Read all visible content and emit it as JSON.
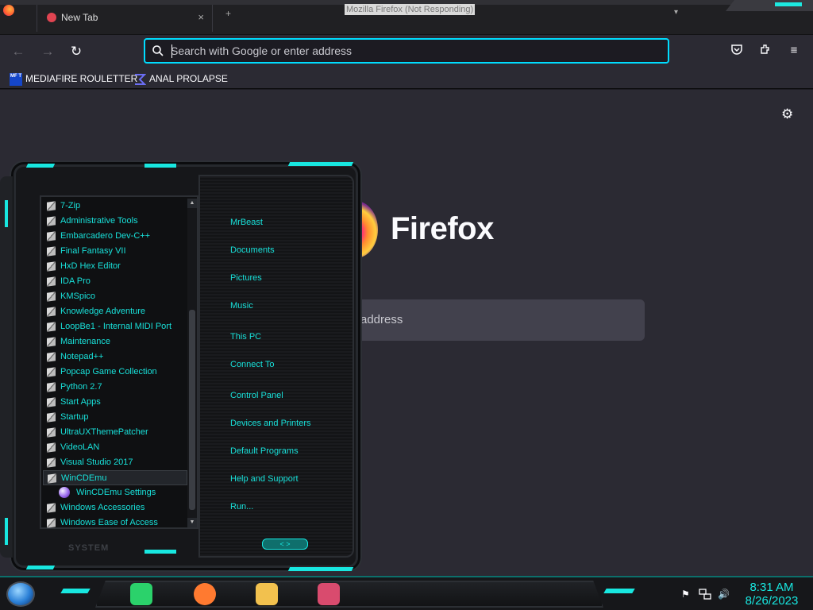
{
  "window": {
    "title_status": "Mozilla Firefox (Not Responding)"
  },
  "tabs": [
    {
      "label": "New Tab",
      "close": "×"
    }
  ],
  "new_tab": "+",
  "tab_list": "▾",
  "toolbar": {
    "back": "←",
    "forward": "→",
    "reload": "↻",
    "url_placeholder": "Search with Google or enter address",
    "pocket": "pocket-icon",
    "extensions": "extensions-icon",
    "menu": "≡"
  },
  "bookmarks": [
    {
      "label": "MEDIAFIRE ROULETTER",
      "icon_text": "MF T"
    },
    {
      "label": "ANAL PROLAPSE"
    }
  ],
  "newtab_page": {
    "wordmark": "Firefox",
    "search_placeholder": "address",
    "settings": "⚙"
  },
  "start_menu": {
    "programs": [
      {
        "label": "7-Zip"
      },
      {
        "label": "Administrative Tools"
      },
      {
        "label": "Embarcadero Dev-C++"
      },
      {
        "label": "Final Fantasy VII"
      },
      {
        "label": "HxD Hex Editor"
      },
      {
        "label": "IDA Pro"
      },
      {
        "label": "KMSpico"
      },
      {
        "label": "Knowledge Adventure"
      },
      {
        "label": "LoopBe1 - Internal MIDI Port"
      },
      {
        "label": "Maintenance"
      },
      {
        "label": "Notepad++"
      },
      {
        "label": "Popcap Game Collection"
      },
      {
        "label": "Python 2.7"
      },
      {
        "label": "Start Apps"
      },
      {
        "label": "Startup"
      },
      {
        "label": "UltraUXThemePatcher"
      },
      {
        "label": "VideoLAN"
      },
      {
        "label": "Visual Studio 2017"
      },
      {
        "label": "WinCDEmu"
      },
      {
        "label": "WinCDEmu Settings"
      },
      {
        "label": "Windows Accessories"
      },
      {
        "label": "Windows Ease of Access"
      }
    ],
    "links": [
      {
        "label": "MrBeast"
      },
      {
        "label": "Documents"
      },
      {
        "label": "Pictures"
      },
      {
        "label": "Music"
      },
      {
        "label": "This PC"
      },
      {
        "label": "Connect To"
      },
      {
        "label": "Control Panel"
      },
      {
        "label": "Devices and Printers"
      },
      {
        "label": "Default Programs"
      },
      {
        "label": "Help and Support"
      },
      {
        "label": "Run..."
      }
    ],
    "system_label": "SYSTEM",
    "pager": "< >",
    "scroll_up": "▲",
    "scroll_down": "▼"
  },
  "taskbar": {
    "pinned": [
      {
        "name": "notes-app-icon",
        "color": "#2bd26b"
      },
      {
        "name": "firefox-icon",
        "color": "#ff7a30"
      },
      {
        "name": "file-explorer-icon",
        "color": "#f2c14e"
      },
      {
        "name": "paint-app-icon",
        "color": "#d94b6e"
      }
    ],
    "tray": {
      "flag": "⚑",
      "network": "network-icon",
      "volume": "🔊"
    },
    "time": "8:31 AM",
    "date": "8/26/2023"
  }
}
